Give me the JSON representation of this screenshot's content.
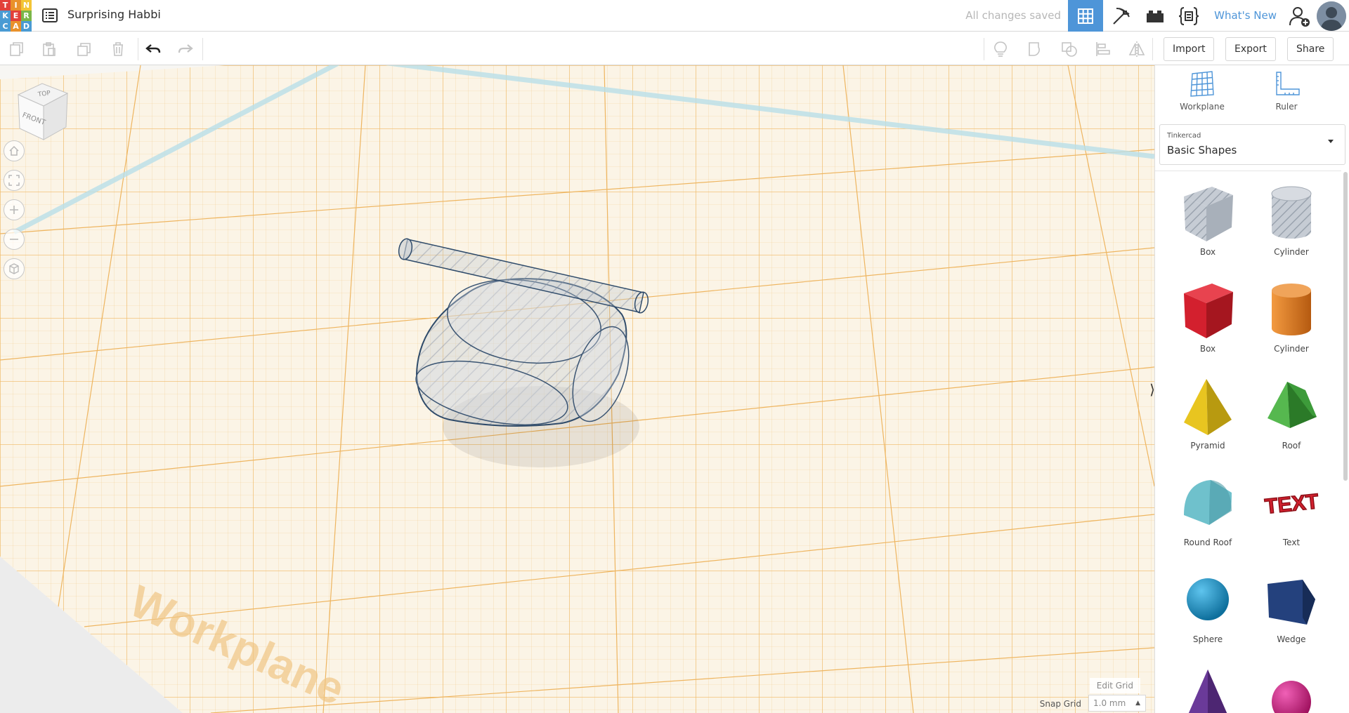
{
  "app": {
    "logo_letters": [
      "T",
      "I",
      "N",
      "K",
      "E",
      "R",
      "C",
      "A",
      "D"
    ],
    "logo_colors": [
      "#e2403a",
      "#e9912b",
      "#f3c536",
      "#4a9bd3",
      "#e2403a",
      "#7ab648",
      "#4a9bd3",
      "#e9912b",
      "#4a9bd3"
    ],
    "design_title": "Surprising Habbi",
    "saved_status": "All changes saved",
    "whats_new": "What's New",
    "accent_color": "#4e95d8"
  },
  "topbar": {
    "icons": [
      "grid-view-icon",
      "pickaxe-icon",
      "bricks-icon",
      "codeblocks-icon",
      "add-user-icon",
      "avatar"
    ]
  },
  "toolbar": {
    "import_label": "Import",
    "export_label": "Export",
    "share_label": "Share",
    "tools": [
      "copy-icon",
      "paste-icon",
      "duplicate-icon",
      "delete-icon",
      "undo-icon",
      "redo-icon",
      "note-icon",
      "group-icon",
      "ungroup-icon",
      "align-icon",
      "mirror-icon"
    ]
  },
  "viewport": {
    "viewcube_top": "TOP",
    "viewcube_front": "FRONT",
    "workplane_watermark": "Workplane",
    "edit_grid_label": "Edit Grid",
    "snap_grid_label": "Snap Grid",
    "snap_grid_value": "1.0 mm",
    "nav_buttons": [
      "home-view-icon",
      "fit-view-icon",
      "zoom-in-icon",
      "zoom-out-icon",
      "projection-icon"
    ]
  },
  "panel": {
    "workplane_label": "Workplane",
    "ruler_label": "Ruler",
    "provider": "Tinkercad",
    "category": "Basic Shapes",
    "shapes": [
      {
        "label": "Box",
        "color": "#b7bcc4",
        "icon": "hole-box-icon"
      },
      {
        "label": "Cylinder",
        "color": "#b7bcc4",
        "icon": "hole-cylinder-icon"
      },
      {
        "label": "Box",
        "color": "#d3202e",
        "icon": "box-icon"
      },
      {
        "label": "Cylinder",
        "color": "#e07a1f",
        "icon": "cylinder-icon"
      },
      {
        "label": "Pyramid",
        "color": "#e8c520",
        "icon": "pyramid-icon"
      },
      {
        "label": "Roof",
        "color": "#3d9b3a",
        "icon": "roof-icon"
      },
      {
        "label": "Round Roof",
        "color": "#6fc1cc",
        "icon": "round-roof-icon"
      },
      {
        "label": "Text",
        "color": "#d3202e",
        "icon": "text-shape-icon",
        "glyph": "TEXT"
      },
      {
        "label": "Sphere",
        "color": "#1a95c9",
        "icon": "sphere-icon"
      },
      {
        "label": "Wedge",
        "color": "#24417d",
        "icon": "wedge-icon"
      },
      {
        "label": "",
        "color": "#6a3a99",
        "icon": "cone-icon"
      },
      {
        "label": "",
        "color": "#d01e84",
        "icon": "paraboloid-icon"
      }
    ]
  }
}
